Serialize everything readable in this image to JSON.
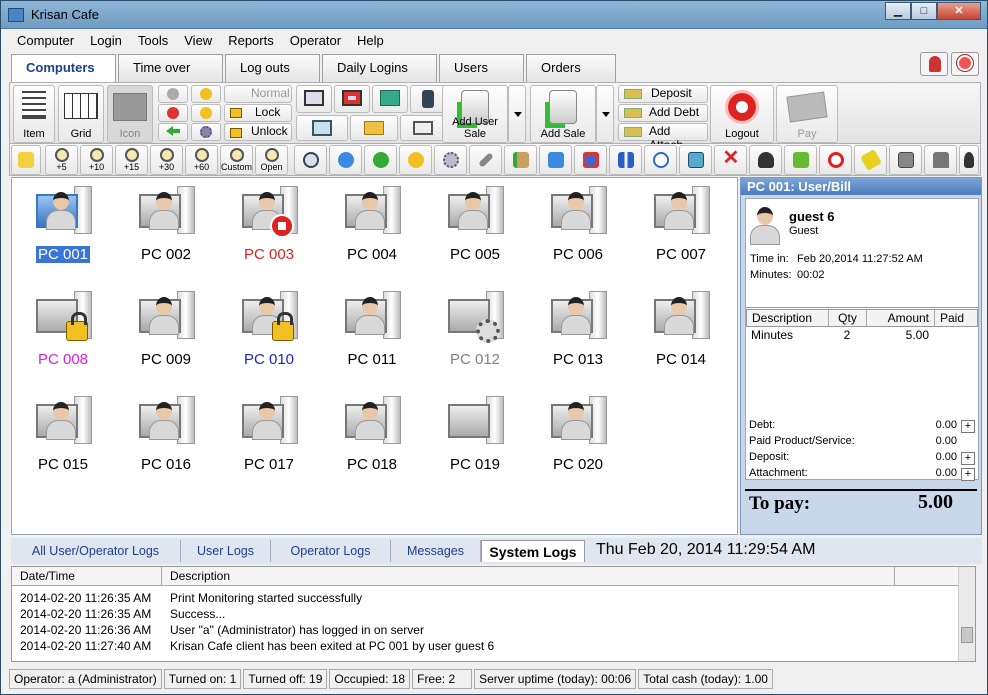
{
  "window": {
    "title": "Krisan Cafe",
    "minimize": "▁",
    "maximize": "□",
    "close": "✕"
  },
  "menu": [
    "Computer",
    "Login",
    "Tools",
    "View",
    "Reports",
    "Operator",
    "Help"
  ],
  "tabs": [
    "Computers",
    "Time over",
    "Log outs",
    "Daily Logins",
    "Users",
    "Orders"
  ],
  "toolbar": {
    "item": "Item",
    "grid": "Grid",
    "icon": "Icon",
    "normal": "Normal",
    "lock": "Lock",
    "unlock": "Unlock",
    "add_user_sale": "Add User Sale",
    "add_sale": "Add Sale",
    "deposit": "Deposit",
    "add_debt": "Add Debt",
    "add_attach": "Add Attach",
    "logout": "Logout",
    "pay": "Pay"
  },
  "time_buttons": [
    "+5",
    "+10",
    "+15",
    "+30",
    "+60",
    "Custom",
    "Open"
  ],
  "pcs": [
    {
      "name": "PC 001",
      "color": "#ffffff",
      "state": "selected"
    },
    {
      "name": "PC 002",
      "color": "#000000",
      "state": "user"
    },
    {
      "name": "PC 003",
      "color": "#e02020",
      "state": "stop"
    },
    {
      "name": "PC 004",
      "color": "#000000",
      "state": "user"
    },
    {
      "name": "PC 005",
      "color": "#000000",
      "state": "user"
    },
    {
      "name": "PC 006",
      "color": "#000000",
      "state": "user"
    },
    {
      "name": "PC 007",
      "color": "#000000",
      "state": "user"
    },
    {
      "name": "PC 008",
      "color": "#e020e0",
      "state": "locked"
    },
    {
      "name": "PC 009",
      "color": "#000000",
      "state": "user"
    },
    {
      "name": "PC 010",
      "color": "#2020d0",
      "state": "unlocked"
    },
    {
      "name": "PC 011",
      "color": "#000000",
      "state": "user"
    },
    {
      "name": "PC 012",
      "color": "#808080",
      "state": "maintenance"
    },
    {
      "name": "PC 013",
      "color": "#000000",
      "state": "user"
    },
    {
      "name": "PC 014",
      "color": "#000000",
      "state": "user"
    },
    {
      "name": "PC 015",
      "color": "#000000",
      "state": "user"
    },
    {
      "name": "PC 016",
      "color": "#000000",
      "state": "user"
    },
    {
      "name": "PC 017",
      "color": "#000000",
      "state": "user"
    },
    {
      "name": "PC 018",
      "color": "#000000",
      "state": "user"
    },
    {
      "name": "PC 019",
      "color": "#000000",
      "state": "free"
    },
    {
      "name": "PC 020",
      "color": "#000000",
      "state": "user"
    }
  ],
  "panel": {
    "title": "PC 001: User/Bill",
    "user_name": "guest 6",
    "user_type": "Guest",
    "time_in_label": "Time in:",
    "time_in": "Feb 20,2014 11:27:52 AM",
    "minutes_label": "Minutes:",
    "minutes": "00:02",
    "bill_headers": [
      "Description",
      "Qty",
      "Amount",
      "Paid"
    ],
    "bill_rows": [
      [
        "Minutes",
        "2",
        "5.00",
        ""
      ]
    ],
    "totals": [
      {
        "label": "Debt:",
        "value": "0.00",
        "plus": true
      },
      {
        "label": "Paid Product/Service:",
        "value": "0.00",
        "plus": false
      },
      {
        "label": "Deposit:",
        "value": "0.00",
        "plus": true
      },
      {
        "label": "Attachment:",
        "value": "0.00",
        "plus": true
      }
    ],
    "to_pay_label": "To pay:",
    "to_pay": "5.00"
  },
  "log_tabs": [
    "All User/Operator Logs",
    "User Logs",
    "Operator Logs",
    "Messages",
    "System Logs"
  ],
  "clock": "Thu Feb 20, 2014  11:29:54 AM",
  "log_headers": [
    "Date/Time",
    "Description"
  ],
  "logs": [
    [
      "2014-02-20 11:26:35 AM",
      "Print Monitoring started successfully"
    ],
    [
      "2014-02-20 11:26:35 AM",
      "Success..."
    ],
    [
      "2014-02-20 11:26:36 AM",
      "User \"a\" (Administrator) has logged in on server"
    ],
    [
      "2014-02-20 11:27:40 AM",
      "Krisan Cafe client has been exited at PC 001 by user guest 6"
    ]
  ],
  "status": [
    "Operator: a (Administrator)",
    "Turned on: 1",
    "Turned off: 19",
    "Occupied: 18",
    "Free: 2",
    "Server uptime (today): 00:06",
    "Total cash (today): 1.00"
  ]
}
